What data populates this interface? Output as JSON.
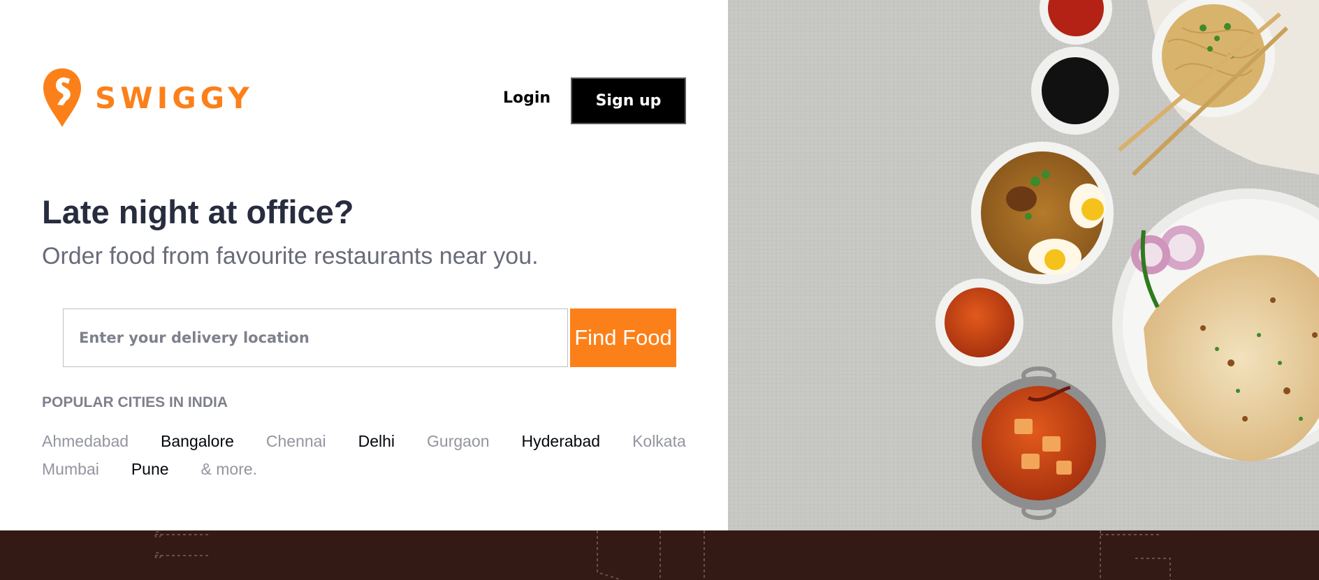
{
  "header": {
    "brand": "SWIGGY",
    "login_label": "Login",
    "signup_label": "Sign up"
  },
  "hero": {
    "headline": "Late night at office?",
    "subheadline": "Order food from favourite restaurants near you."
  },
  "search": {
    "placeholder": "Enter your delivery location",
    "value": "",
    "button_label": "Find Food"
  },
  "popular": {
    "title": "POPULAR CITIES IN INDIA",
    "cities": [
      {
        "name": "Ahmedabad",
        "tone": "light"
      },
      {
        "name": "Bangalore",
        "tone": "dark"
      },
      {
        "name": "Chennai",
        "tone": "light"
      },
      {
        "name": "Delhi",
        "tone": "dark"
      },
      {
        "name": "Gurgaon",
        "tone": "light"
      },
      {
        "name": "Hyderabad",
        "tone": "dark"
      },
      {
        "name": "Kolkata",
        "tone": "light"
      },
      {
        "name": "Mumbai",
        "tone": "light"
      },
      {
        "name": "Pune",
        "tone": "dark"
      }
    ],
    "more_label": "& more."
  },
  "colors": {
    "brand_orange": "#fc8019",
    "headline": "#282c3f",
    "subheadline": "#686b78",
    "footer_band": "#331a14",
    "image_background": "#c9c9c6"
  },
  "icons": {
    "logo": "swiggy-logo-icon"
  }
}
